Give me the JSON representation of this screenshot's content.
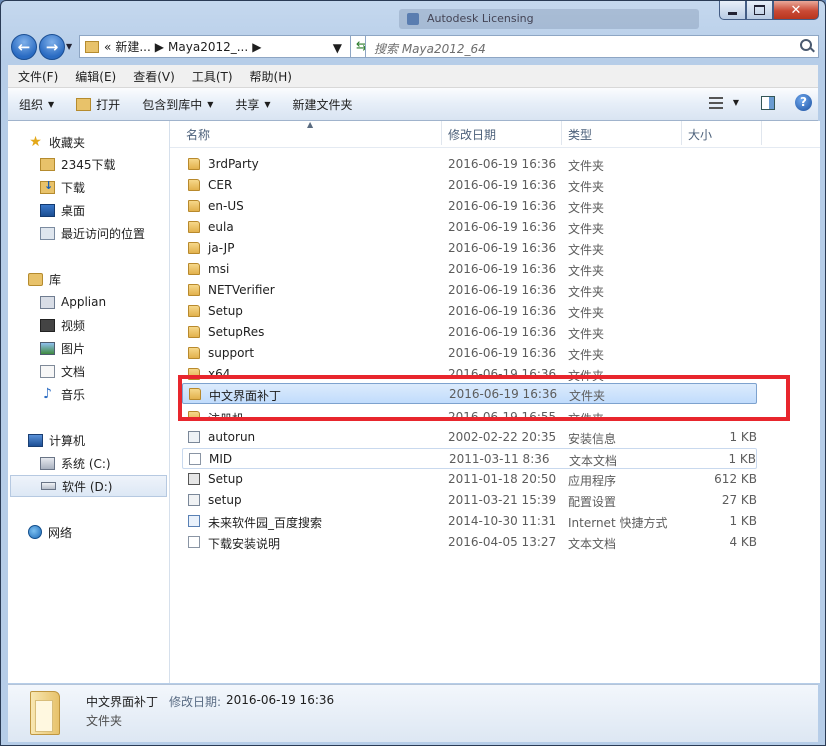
{
  "window": {
    "background_title": "Autodesk Licensing",
    "close_glyph": "✕"
  },
  "address": {
    "crumbs": [
      "«",
      "新建...",
      "Maya2012_..."
    ],
    "search_placeholder": "搜索 Maya2012_64"
  },
  "menu": [
    "文件(F)",
    "编辑(E)",
    "查看(V)",
    "工具(T)",
    "帮助(H)"
  ],
  "toolbar": {
    "organize": "组织",
    "open": "打开",
    "include_library": "包含到库中",
    "share": "共享",
    "new_folder": "新建文件夹"
  },
  "nav": {
    "favorites": "收藏夹",
    "fav_items": [
      "2345下载",
      "下载",
      "桌面",
      "最近访问的位置"
    ],
    "libraries": "库",
    "lib_items": [
      "Applian",
      "视频",
      "图片",
      "文档",
      "音乐"
    ],
    "computer": "计算机",
    "drives": [
      "系统 (C:)",
      "软件 (D:)"
    ],
    "network": "网络"
  },
  "columns": {
    "name": "名称",
    "date": "修改日期",
    "type": "类型",
    "size": "大小"
  },
  "files": [
    {
      "name": "3rdParty",
      "date": "2016-06-19 16:36",
      "type": "文件夹",
      "size": "",
      "icon": "folder-icon"
    },
    {
      "name": "CER",
      "date": "2016-06-19 16:36",
      "type": "文件夹",
      "size": "",
      "icon": "folder-icon"
    },
    {
      "name": "en-US",
      "date": "2016-06-19 16:36",
      "type": "文件夹",
      "size": "",
      "icon": "folder-icon"
    },
    {
      "name": "eula",
      "date": "2016-06-19 16:36",
      "type": "文件夹",
      "size": "",
      "icon": "folder-icon"
    },
    {
      "name": "ja-JP",
      "date": "2016-06-19 16:36",
      "type": "文件夹",
      "size": "",
      "icon": "folder-icon"
    },
    {
      "name": "msi",
      "date": "2016-06-19 16:36",
      "type": "文件夹",
      "size": "",
      "icon": "folder-icon"
    },
    {
      "name": "NETVerifier",
      "date": "2016-06-19 16:36",
      "type": "文件夹",
      "size": "",
      "icon": "folder-icon"
    },
    {
      "name": "Setup",
      "date": "2016-06-19 16:36",
      "type": "文件夹",
      "size": "",
      "icon": "folder-icon"
    },
    {
      "name": "SetupRes",
      "date": "2016-06-19 16:36",
      "type": "文件夹",
      "size": "",
      "icon": "folder-icon"
    },
    {
      "name": "support",
      "date": "2016-06-19 16:36",
      "type": "文件夹",
      "size": "",
      "icon": "folder-icon"
    },
    {
      "name": "x64",
      "date": "2016-06-19 16:36",
      "type": "文件夹",
      "size": "",
      "icon": "folder-icon"
    },
    {
      "name": "中文界面补丁",
      "date": "2016-06-19 16:36",
      "type": "文件夹",
      "size": "",
      "icon": "folder-icon"
    },
    {
      "name": "注册机",
      "date": "2016-06-19 16:55",
      "type": "文件夹",
      "size": "",
      "icon": "folder-icon"
    },
    {
      "name": "autorun",
      "date": "2002-02-22 20:35",
      "type": "安装信息",
      "size": "1 KB",
      "icon": "setup-info-icon"
    },
    {
      "name": "MID",
      "date": "2011-03-11 8:36",
      "type": "文本文档",
      "size": "1 KB",
      "icon": "text-document-icon"
    },
    {
      "name": "Setup",
      "date": "2011-01-18 20:50",
      "type": "应用程序",
      "size": "612 KB",
      "icon": "application-icon"
    },
    {
      "name": "setup",
      "date": "2011-03-21 15:39",
      "type": "配置设置",
      "size": "27 KB",
      "icon": "config-icon"
    },
    {
      "name": "未来软件园_百度搜索",
      "date": "2014-10-30 11:31",
      "type": "Internet 快捷方式",
      "size": "1 KB",
      "icon": "internet-shortcut-icon"
    },
    {
      "name": "下载安装说明",
      "date": "2016-04-05 13:27",
      "type": "文本文档",
      "size": "4 KB",
      "icon": "text-document-icon"
    }
  ],
  "details": {
    "name": "中文界面补丁",
    "date_label": "修改日期:",
    "date": "2016-06-19 16:36",
    "type": "文件夹"
  },
  "colors": {
    "highlight_box": "#e8262d",
    "selection": "#c1dcfc"
  }
}
